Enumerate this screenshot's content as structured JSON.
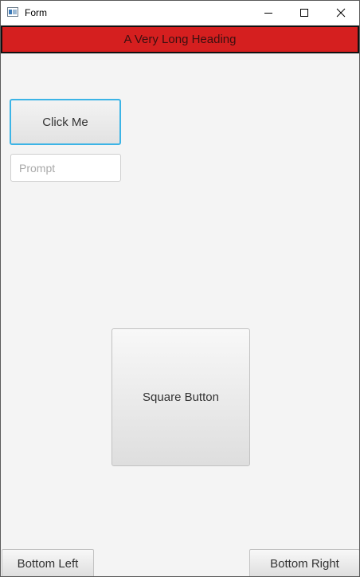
{
  "window": {
    "title": "Form",
    "icon": "app-window-icon",
    "controls": [
      "minimize-icon",
      "maximize-icon",
      "close-icon"
    ]
  },
  "heading": {
    "text": "A Very Long Heading",
    "background": "#d51f1f",
    "border": "#111111"
  },
  "click_me_button": {
    "label": "Click Me",
    "focus_color": "#3cb4e6"
  },
  "prompt_field": {
    "value": "",
    "placeholder": "Prompt"
  },
  "square_button": {
    "label": "Square Button"
  },
  "bottom_left_button": {
    "label": "Bottom Left"
  },
  "bottom_right_button": {
    "label": "Bottom Right"
  }
}
